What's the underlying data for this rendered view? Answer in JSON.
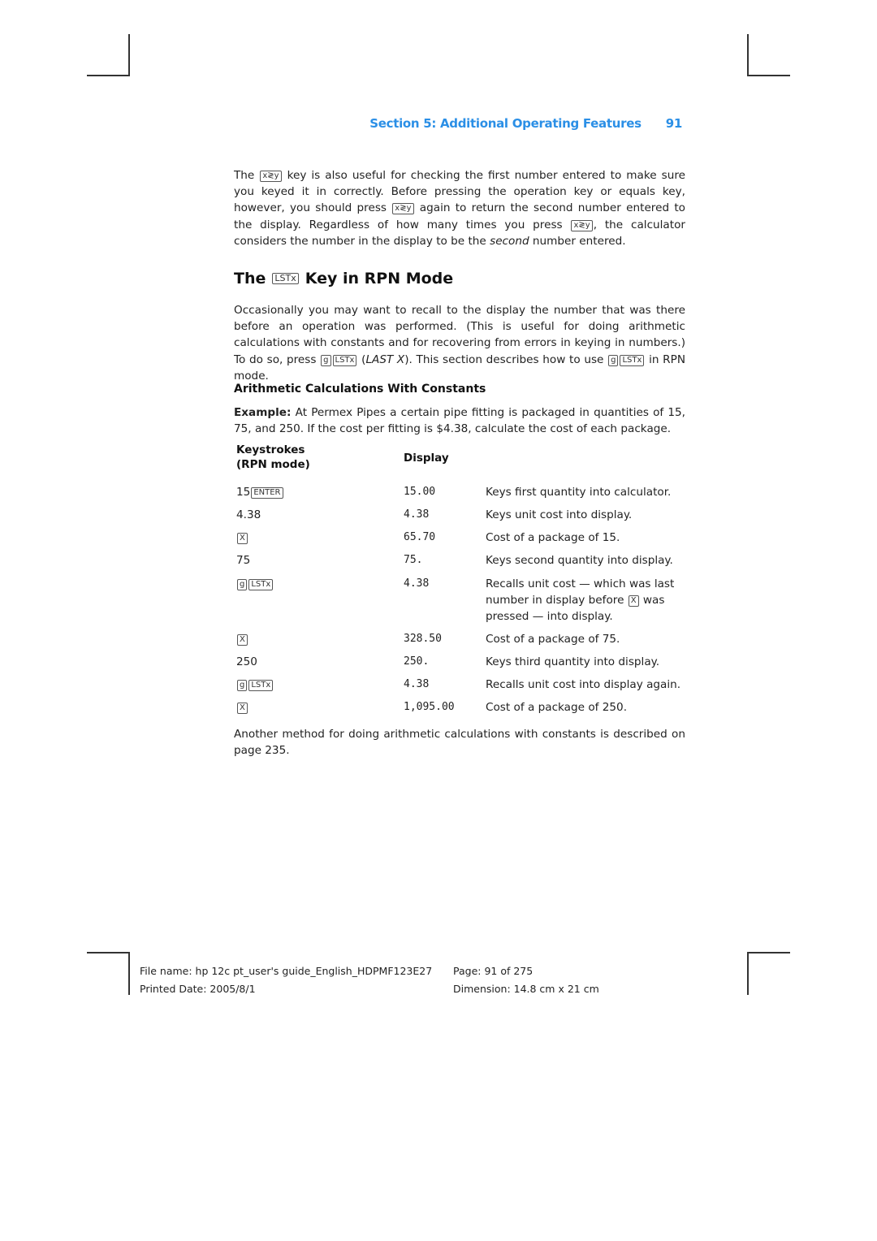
{
  "header": {
    "section_title": "Section 5: Additional Operating Features",
    "page_number": "91"
  },
  "intro": {
    "p1_a": "The",
    "key_xy": "x≷y",
    "p1_b": "key is also useful for checking the first number entered to make sure you keyed it in correctly. Before pressing the operation key or equals key, however, you should press",
    "p1_c": "again to return the second number entered to the display. Regardless of how many times you press",
    "p1_d": ", the calculator considers the number in the display to be the",
    "p1_em": "second",
    "p1_e": "number entered."
  },
  "heading": {
    "pre": "The",
    "key": "LSTx",
    "post": "Key in RPN Mode"
  },
  "para2": {
    "a": "Occasionally you may want to recall to the display the number that was there before an operation was performed. (This is useful for doing arithmetic calculations with constants and for recovering from errors in keying in numbers.) To do so, press",
    "key_g": "g",
    "key_lstx": "LSTx",
    "em": "LAST X",
    "b": "). This section describes how to use",
    "c": "in RPN mode.",
    "paren_open": "("
  },
  "subheading": "Arithmetic Calculations With Constants",
  "example": {
    "label": "Example:",
    "text": "At Permex Pipes a certain pipe fitting is packaged in quantities of 15, 75, and 250. If the cost per fitting is $4.38, calculate the cost of each package."
  },
  "table": {
    "col_keystrokes_1": "Keystrokes",
    "col_keystrokes_2": "(RPN mode)",
    "col_display": "Display",
    "rows": [
      {
        "keys_text": "15",
        "keys": [
          "ENTER"
        ],
        "display": "15.00",
        "comment": "Keys first quantity into calculator."
      },
      {
        "keys_text": "4.38",
        "keys": [],
        "display": "4.38",
        "comment": "Keys unit cost into display."
      },
      {
        "keys_text": "",
        "keys": [
          "X"
        ],
        "display": "65.70",
        "comment": "Cost of a package of 15."
      },
      {
        "keys_text": "75",
        "keys": [],
        "display": "75.",
        "comment": "Keys second quantity into display."
      },
      {
        "keys_text": "",
        "keys": [
          "g",
          "LSTx"
        ],
        "display": "4.38",
        "comment_a": "Recalls unit cost — which was last number in display before",
        "comment_key": "X",
        "comment_b": "was pressed — into display."
      },
      {
        "keys_text": "",
        "keys": [
          "X"
        ],
        "display": "328.50",
        "comment": "Cost of a package of 75."
      },
      {
        "keys_text": "250",
        "keys": [],
        "display": "250.",
        "comment": "Keys third quantity into display."
      },
      {
        "keys_text": "",
        "keys": [
          "g",
          "LSTx"
        ],
        "display": "4.38",
        "comment": "Recalls unit cost into display again."
      },
      {
        "keys_text": "",
        "keys": [
          "X"
        ],
        "display": "1,095.00",
        "comment": "Cost of a package of 250."
      }
    ]
  },
  "closing": "Another method for doing arithmetic calculations with constants is described on page 235.",
  "footer": {
    "file_name": "File name: hp 12c pt_user's guide_English_HDPMF123E27",
    "page": "Page: 91 of 275",
    "printed_date": "Printed Date: 2005/8/1",
    "dimension": "Dimension: 14.8 cm x 21 cm"
  }
}
